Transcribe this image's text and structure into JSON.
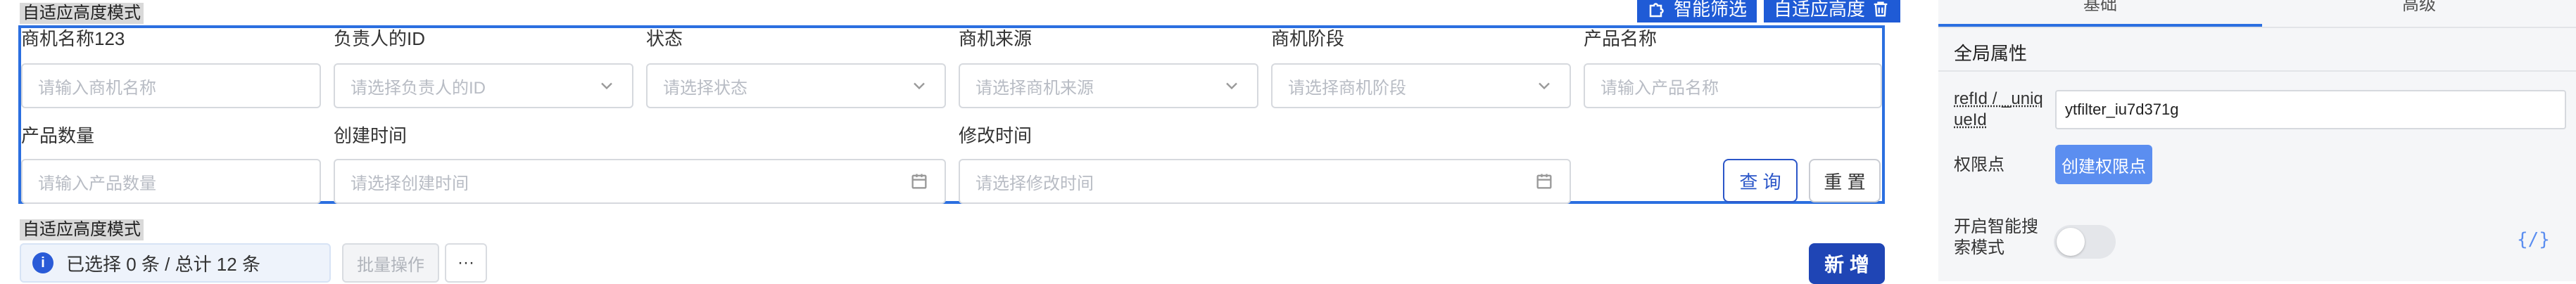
{
  "top_toolbar": {
    "mode_label": "自适应高度模式",
    "smart_filter_label": "智能筛选",
    "adaptive_label": "自适应高度"
  },
  "filter": {
    "fields": [
      {
        "label": "商机名称123",
        "placeholder": "请输入商机名称"
      },
      {
        "label": "负责人的ID",
        "placeholder": "请选择负责人的ID"
      },
      {
        "label": "状态",
        "placeholder": "请选择状态"
      },
      {
        "label": "商机来源",
        "placeholder": "请选择商机来源"
      },
      {
        "label": "商机阶段",
        "placeholder": "请选择商机阶段"
      },
      {
        "label": "产品名称",
        "placeholder": "请输入产品名称"
      },
      {
        "label": "产品数量",
        "placeholder": "请输入产品数量"
      },
      {
        "label": "创建时间",
        "placeholder": "请选择创建时间"
      },
      {
        "label": "修改时间",
        "placeholder": "请选择修改时间"
      }
    ],
    "query_label": "查 询",
    "reset_label": "重 置"
  },
  "table_toolbar": {
    "mode_label": "自适应高度模式",
    "selection_text": "已选择 0 条 / 总计 12 条",
    "batch_label": "批量操作",
    "more_label": "···",
    "add_label": "新 增"
  },
  "right_panel": {
    "tabs": [
      "基础",
      "高级"
    ],
    "active_tab": "基础",
    "section_title": "全局属性",
    "ref_label": "refId / _uniqueId",
    "ref_value": "ytfilter_iu7d371g",
    "permission_label": "权限点",
    "create_permission_label": "创建权限点",
    "smart_search_label": "开启智能搜索模式",
    "smart_search_on": false,
    "code_icon_text": "{/}"
  },
  "colors": {
    "accent": "#1f5bd6",
    "border_highlight": "#2b6fe0",
    "primary_button": "#1f45b5",
    "panel_bg": "#f5f6f8"
  }
}
